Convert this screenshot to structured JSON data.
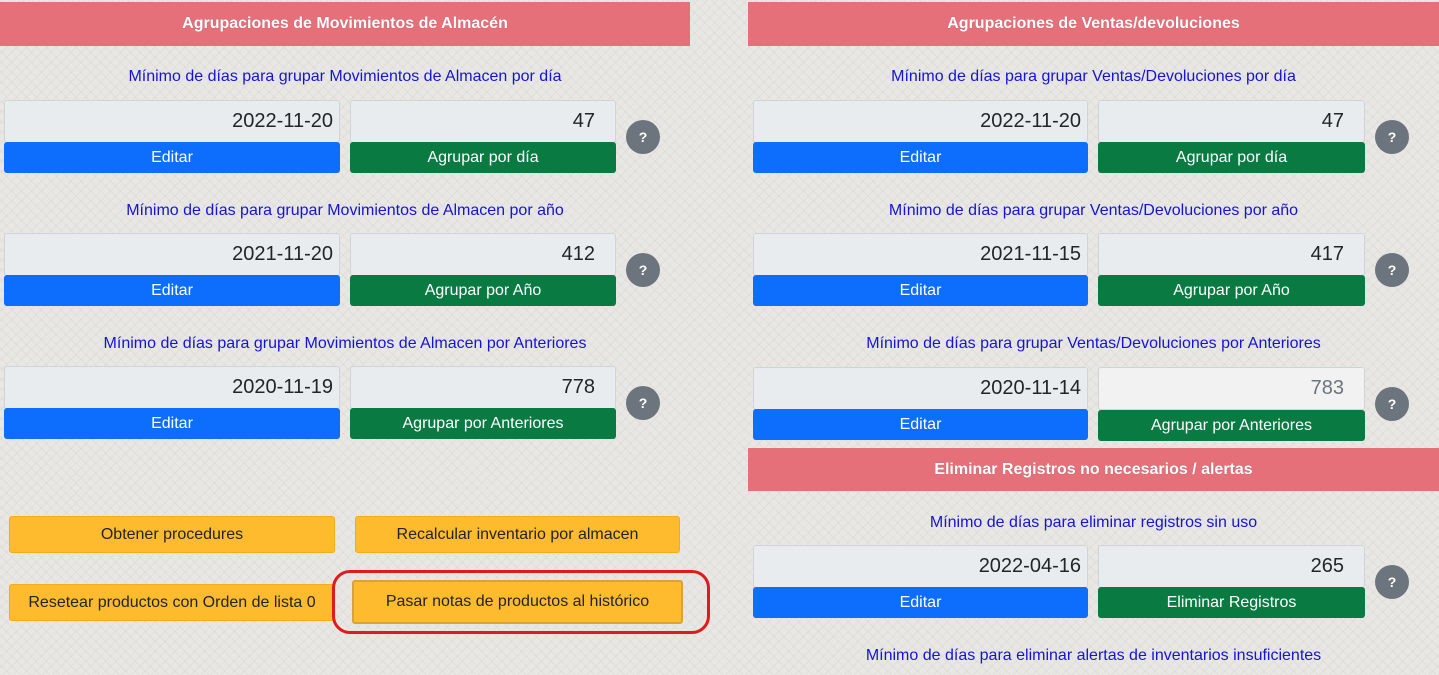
{
  "left": {
    "header": "Agrupaciones de Movimientos de Almacén",
    "rows": [
      {
        "caption": "Mínimo de días para grupar Movimientos de Almacen por día",
        "date": "2022-11-20",
        "days": "47",
        "edit": "Editar",
        "action": "Agrupar por día",
        "help": "?"
      },
      {
        "caption": "Mínimo de días para grupar Movimientos de Almacen por año",
        "date": "2021-11-20",
        "days": "412",
        "edit": "Editar",
        "action": "Agrupar por Año",
        "help": "?"
      },
      {
        "caption": "Mínimo de días para grupar Movimientos de Almacen por Anteriores",
        "date": "2020-11-19",
        "days": "778",
        "edit": "Editar",
        "action": "Agrupar por Anteriores",
        "help": "?"
      }
    ],
    "tools": {
      "obtener": "Obtener procedures",
      "recalcular": "Recalcular inventario por almacen",
      "resetear": "Resetear productos con Orden de lista 0",
      "pasar": "Pasar notas de productos al histórico"
    }
  },
  "right": {
    "header": "Agrupaciones de Ventas/devoluciones",
    "rows": [
      {
        "caption": "Mínimo de días para grupar Ventas/Devoluciones por día",
        "date": "2022-11-20",
        "days": "47",
        "edit": "Editar",
        "action": "Agrupar por día",
        "help": "?"
      },
      {
        "caption": "Mínimo de días para grupar Ventas/Devoluciones por año",
        "date": "2021-11-15",
        "days": "417",
        "edit": "Editar",
        "action": "Agrupar por Año",
        "help": "?"
      },
      {
        "caption": "Mínimo de días para grupar Ventas/Devoluciones por Anteriores",
        "date": "2020-11-14",
        "days": "783",
        "edit": "Editar",
        "action": "Agrupar por Anteriores",
        "help": "?"
      }
    ],
    "header2": "Eliminar Registros no necesarios / alertas",
    "eliminar": {
      "caption": "Mínimo de días para eliminar registros sin uso",
      "date": "2022-04-16",
      "days": "265",
      "edit": "Editar",
      "action": "Eliminar Registros",
      "help": "?"
    },
    "alertas_caption": "Mínimo de días para eliminar alertas de inventarios insuficientes"
  },
  "colors": {
    "header": "#e5707a",
    "caption": "#1414d6",
    "blue": "#0d6efd",
    "green": "#0a7a43",
    "yellow": "#fdbb2d",
    "highlight": "#e01b1b"
  }
}
